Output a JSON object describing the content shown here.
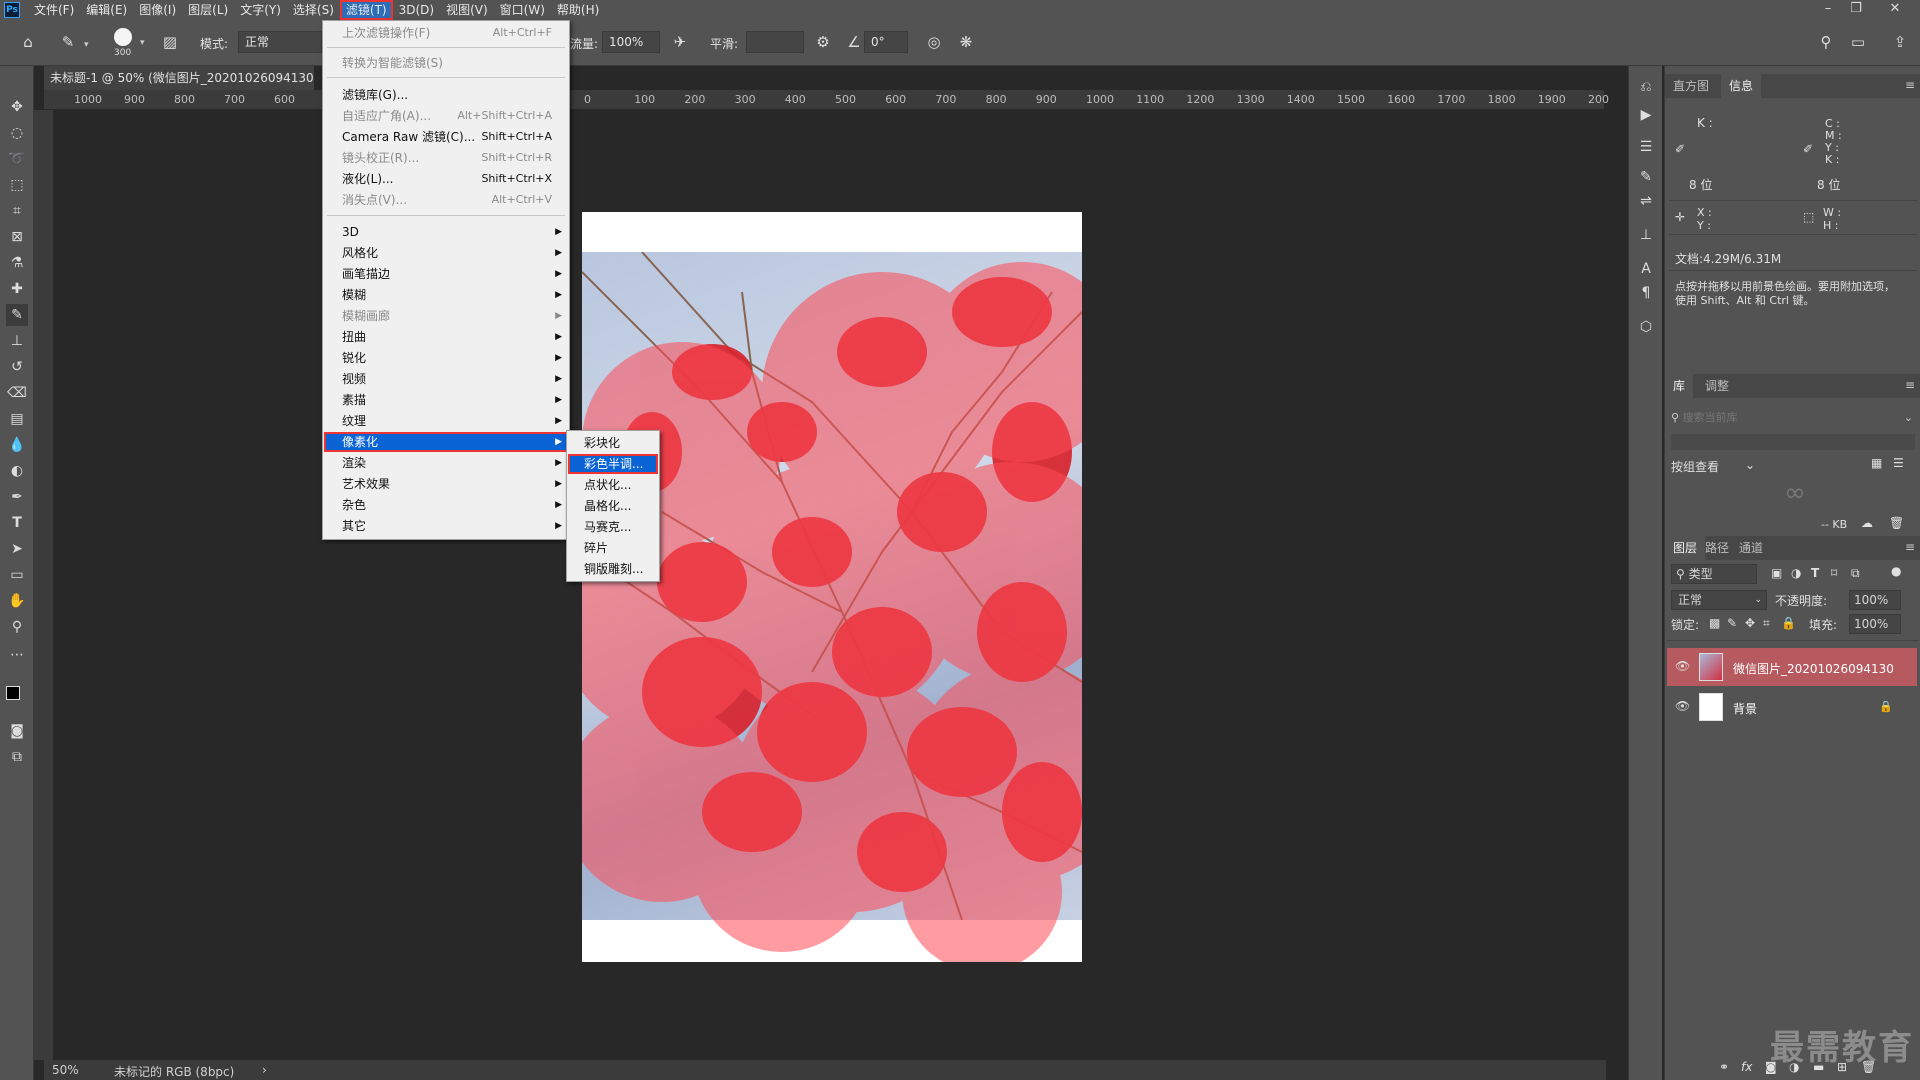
{
  "app": {
    "logo": "Ps"
  },
  "menubar": {
    "items": [
      "文件(F)",
      "编辑(E)",
      "图像(I)",
      "图层(L)",
      "文字(Y)",
      "选择(S)",
      "滤镜(T)",
      "3D(D)",
      "视图(V)",
      "窗口(W)",
      "帮助(H)"
    ],
    "active": "滤镜(T)",
    "window_controls": [
      "minimize-icon",
      "restore-icon",
      "close-icon"
    ]
  },
  "options": {
    "brush_size": "300",
    "mode_label": "模式:",
    "mode_value": "正常",
    "flow_label": "流量:",
    "flow_value": "100%",
    "smooth_label": "平滑:",
    "smooth_value": "",
    "angle_value": "0°"
  },
  "document": {
    "tab_title": "未标题-1 @ 50% (微信图片_20201026094130, ...",
    "zoom": "50%",
    "color_info": "未标记的 RGB (8bpc)"
  },
  "ruler": {
    "h_ticks": [
      "1000",
      "900",
      "800",
      "700",
      "600",
      "0",
      "100",
      "200",
      "300",
      "400",
      "500",
      "600",
      "700",
      "800",
      "900",
      "1000",
      "1100",
      "1200",
      "1300",
      "1400",
      "1500",
      "1600",
      "1700",
      "1800",
      "1900",
      "200"
    ]
  },
  "filter_menu": {
    "items": [
      {
        "label": "上次滤镜操作(F)",
        "shortcut": "Alt+Ctrl+F",
        "disabled": true
      },
      {
        "sep": true
      },
      {
        "label": "转换为智能滤镜(S)",
        "shortcut": "",
        "disabled": true
      },
      {
        "sep": true
      },
      {
        "label": "滤镜库(G)...",
        "shortcut": ""
      },
      {
        "label": "自适应广角(A)...",
        "shortcut": "Alt+Shift+Ctrl+A",
        "disabled": true
      },
      {
        "label": "Camera Raw 滤镜(C)...",
        "shortcut": "Shift+Ctrl+A"
      },
      {
        "label": "镜头校正(R)...",
        "shortcut": "Shift+Ctrl+R",
        "disabled": true
      },
      {
        "label": "液化(L)...",
        "shortcut": "Shift+Ctrl+X"
      },
      {
        "label": "消失点(V)...",
        "shortcut": "Alt+Ctrl+V",
        "disabled": true
      },
      {
        "sep": true
      },
      {
        "label": "3D",
        "submenu": true
      },
      {
        "label": "风格化",
        "submenu": true
      },
      {
        "label": "画笔描边",
        "submenu": true
      },
      {
        "label": "模糊",
        "submenu": true
      },
      {
        "label": "模糊画廊",
        "submenu": true,
        "disabled": true
      },
      {
        "label": "扭曲",
        "submenu": true
      },
      {
        "label": "锐化",
        "submenu": true
      },
      {
        "label": "视频",
        "submenu": true
      },
      {
        "label": "素描",
        "submenu": true
      },
      {
        "label": "纹理",
        "submenu": true
      },
      {
        "label": "像素化",
        "submenu": true,
        "selected": true
      },
      {
        "label": "渲染",
        "submenu": true
      },
      {
        "label": "艺术效果",
        "submenu": true
      },
      {
        "label": "杂色",
        "submenu": true
      },
      {
        "label": "其它",
        "submenu": true
      }
    ]
  },
  "pixelate_submenu": {
    "items": [
      "彩块化",
      "彩色半调...",
      "点状化...",
      "晶格化...",
      "马赛克...",
      "碎片",
      "铜版雕刻..."
    ],
    "selected": "彩色半调..."
  },
  "info_panel": {
    "tabs": [
      "直方图",
      "信息"
    ],
    "active_tab": "信息",
    "k_label": "K :",
    "cmyk_labels": [
      "C :",
      "M :",
      "Y :",
      "K :"
    ],
    "bits_left": "8 位",
    "bits_right": "8 位",
    "xy_labels": [
      "X :",
      "Y :"
    ],
    "wh_labels": [
      "W :",
      "H :"
    ],
    "doc_size": "文档:4.29M/6.31M",
    "hint": "点按并拖移以用前景色绘画。要用附加选项，使用 Shift、Alt 和 Ctrl 键。"
  },
  "library_panel": {
    "tabs": [
      "库",
      "调整"
    ],
    "active_tab": "库",
    "search_placeholder": "搜索当前库",
    "view_label": "按组查看",
    "size_label": "-- KB"
  },
  "layers_panel": {
    "tabs": [
      "图层",
      "路径",
      "通道"
    ],
    "active_tab": "图层",
    "filter_label": "类型",
    "blend_mode": "正常",
    "opacity_label": "不透明度:",
    "opacity_value": "100%",
    "lock_label": "锁定:",
    "fill_label": "填充:",
    "fill_value": "100%",
    "layers": [
      {
        "name": "微信图片_20201026094130",
        "selected": true
      },
      {
        "name": "背景",
        "locked": true
      }
    ]
  },
  "watermark": "最需教育",
  "colors": {
    "accent": "#0a64d6",
    "highlight_outline": "#e33333",
    "panel_bg": "#535353",
    "canvas_bg": "#282828",
    "layer_selected": "#b75a5f"
  }
}
